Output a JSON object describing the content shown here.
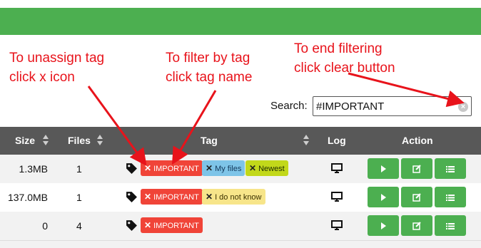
{
  "annotations": {
    "unassign": [
      "To unassign tag",
      "click x icon"
    ],
    "filter": [
      "To filter by tag",
      "click tag name"
    ],
    "end_filter": [
      "To end filtering",
      "click clear button"
    ]
  },
  "search": {
    "label": "Search:",
    "value": "#IMPORTANT",
    "clear_icon": "×"
  },
  "table": {
    "headers": {
      "size": "Size",
      "files": "Files",
      "tag": "Tag",
      "log": "Log",
      "action": "Action"
    },
    "rows": [
      {
        "size": "1.3MB",
        "files": "1",
        "tags": [
          {
            "x": "✕",
            "label": "IMPORTANT"
          },
          {
            "x": "✕",
            "label": "My files"
          },
          {
            "x": "✕",
            "label": "Newest"
          }
        ]
      },
      {
        "size": "137.0MB",
        "files": "1",
        "tags": [
          {
            "x": "✕",
            "label": "IMPORTANT"
          },
          {
            "x": "✕",
            "label": "I do not know"
          }
        ]
      },
      {
        "size": "0",
        "files": "4",
        "tags": [
          {
            "x": "✕",
            "label": "IMPORTANT"
          }
        ]
      }
    ]
  },
  "colors": {
    "topbar": "#4caf50",
    "annotation": "#e8131b",
    "header_bg": "#585858",
    "action_button": "#4caf50",
    "tag_important": "#f04438",
    "tag_myfiles": "#7ec4e8",
    "tag_newest": "#c2d81a",
    "tag_idk": "#f7e58a"
  },
  "icons": [
    "tag-icon",
    "monitor-icon",
    "play-icon",
    "edit-icon",
    "list-icon",
    "sort-icon",
    "clear-icon"
  ]
}
